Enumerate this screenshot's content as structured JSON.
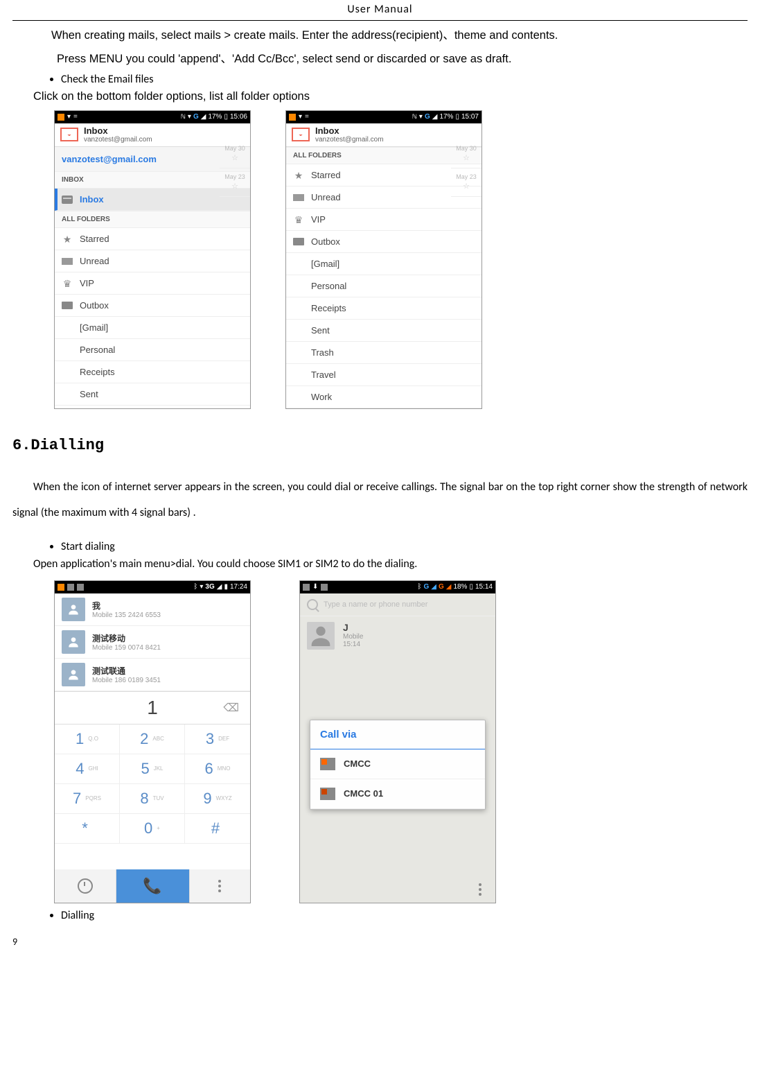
{
  "header": {
    "title": "User    Manual"
  },
  "intro": {
    "line1": "When creating mails, select mails > create mails. Enter the address(recipient)、theme and contents.",
    "line2": "Press MENU you could 'append'、'Add Cc/Bcc',    select send or discarded or save as draft."
  },
  "bullet_check": "Check the Email files",
  "folder_text": "Click on the bottom folder options, list all folder options",
  "statusbar": {
    "net": "G",
    "battery_pct_a": "17%",
    "time_a": "15:06",
    "battery_pct_b": "17%",
    "time_b": "15:07",
    "net3g": "3G",
    "battery_pct_c": "",
    "time_c": "17:24",
    "battery_pct_d": "18%",
    "time_d": "15:14"
  },
  "inbox": {
    "title": "Inbox",
    "email": "vanzotest@gmail.com"
  },
  "account_row": "vanzotest@gmail.com",
  "sections": {
    "inbox_label": "INBOX",
    "all_folders": "ALL FOLDERS"
  },
  "folders_a": [
    {
      "name": "Inbox",
      "icon": "inbox",
      "selected": true
    },
    {
      "name": "Starred",
      "icon": "star"
    },
    {
      "name": "Unread",
      "icon": "mail"
    },
    {
      "name": "VIP",
      "icon": "crown"
    },
    {
      "name": "Outbox",
      "icon": "box"
    },
    {
      "name": "[Gmail]",
      "icon": ""
    },
    {
      "name": "Personal",
      "icon": ""
    },
    {
      "name": "Receipts",
      "icon": ""
    },
    {
      "name": "Sent",
      "icon": ""
    }
  ],
  "folders_b": [
    {
      "name": "Starred",
      "icon": "star"
    },
    {
      "name": "Unread",
      "icon": "mail"
    },
    {
      "name": "VIP",
      "icon": "crown"
    },
    {
      "name": "Outbox",
      "icon": "box"
    },
    {
      "name": "[Gmail]",
      "icon": ""
    },
    {
      "name": "Personal",
      "icon": ""
    },
    {
      "name": "Receipts",
      "icon": ""
    },
    {
      "name": "Sent",
      "icon": ""
    },
    {
      "name": "Trash",
      "icon": ""
    },
    {
      "name": "Travel",
      "icon": ""
    },
    {
      "name": "Work",
      "icon": ""
    }
  ],
  "ghost_dates": [
    "May 30",
    "May 23"
  ],
  "heading6": "6.Dialling",
  "dial_intro": "When the icon of internet server appears in the screen, you could dial or receive callings. The signal bar on the top right corner show the strength of network signal (the maximum with 4 signal bars) .",
  "bullet_start": "Start dialing",
  "open_text": "Open application's main menu>dial. You could choose SIM1 or SIM2 to do the dialing.",
  "contacts": [
    {
      "name": "我",
      "sub": "Mobile 135 2424 6553"
    },
    {
      "name": "测试移动",
      "sub": "Mobile 159 0074 8421"
    },
    {
      "name": "测试联通",
      "sub": "Mobile 186 0189 3451"
    }
  ],
  "dial_display": "1",
  "keypad": [
    {
      "num": "1",
      "letters": "Q.O"
    },
    {
      "num": "2",
      "letters": "ABC"
    },
    {
      "num": "3",
      "letters": "DEF"
    },
    {
      "num": "4",
      "letters": "GHI"
    },
    {
      "num": "5",
      "letters": "JKL"
    },
    {
      "num": "6",
      "letters": "MNO"
    },
    {
      "num": "7",
      "letters": "PQRS"
    },
    {
      "num": "8",
      "letters": "TUV"
    },
    {
      "num": "9",
      "letters": "WXYZ"
    },
    {
      "num": "*",
      "letters": ""
    },
    {
      "num": "0",
      "letters": "+"
    },
    {
      "num": "#",
      "letters": ""
    }
  ],
  "screen2b": {
    "search_placeholder": "Type a name or phone number",
    "contact_name": "J",
    "contact_type": "Mobile",
    "contact_time": "15:14"
  },
  "dialog": {
    "title": "Call via",
    "options": [
      "CMCC",
      "CMCC 01"
    ]
  },
  "bullet_dialling": "Dialling",
  "page_number": "9"
}
